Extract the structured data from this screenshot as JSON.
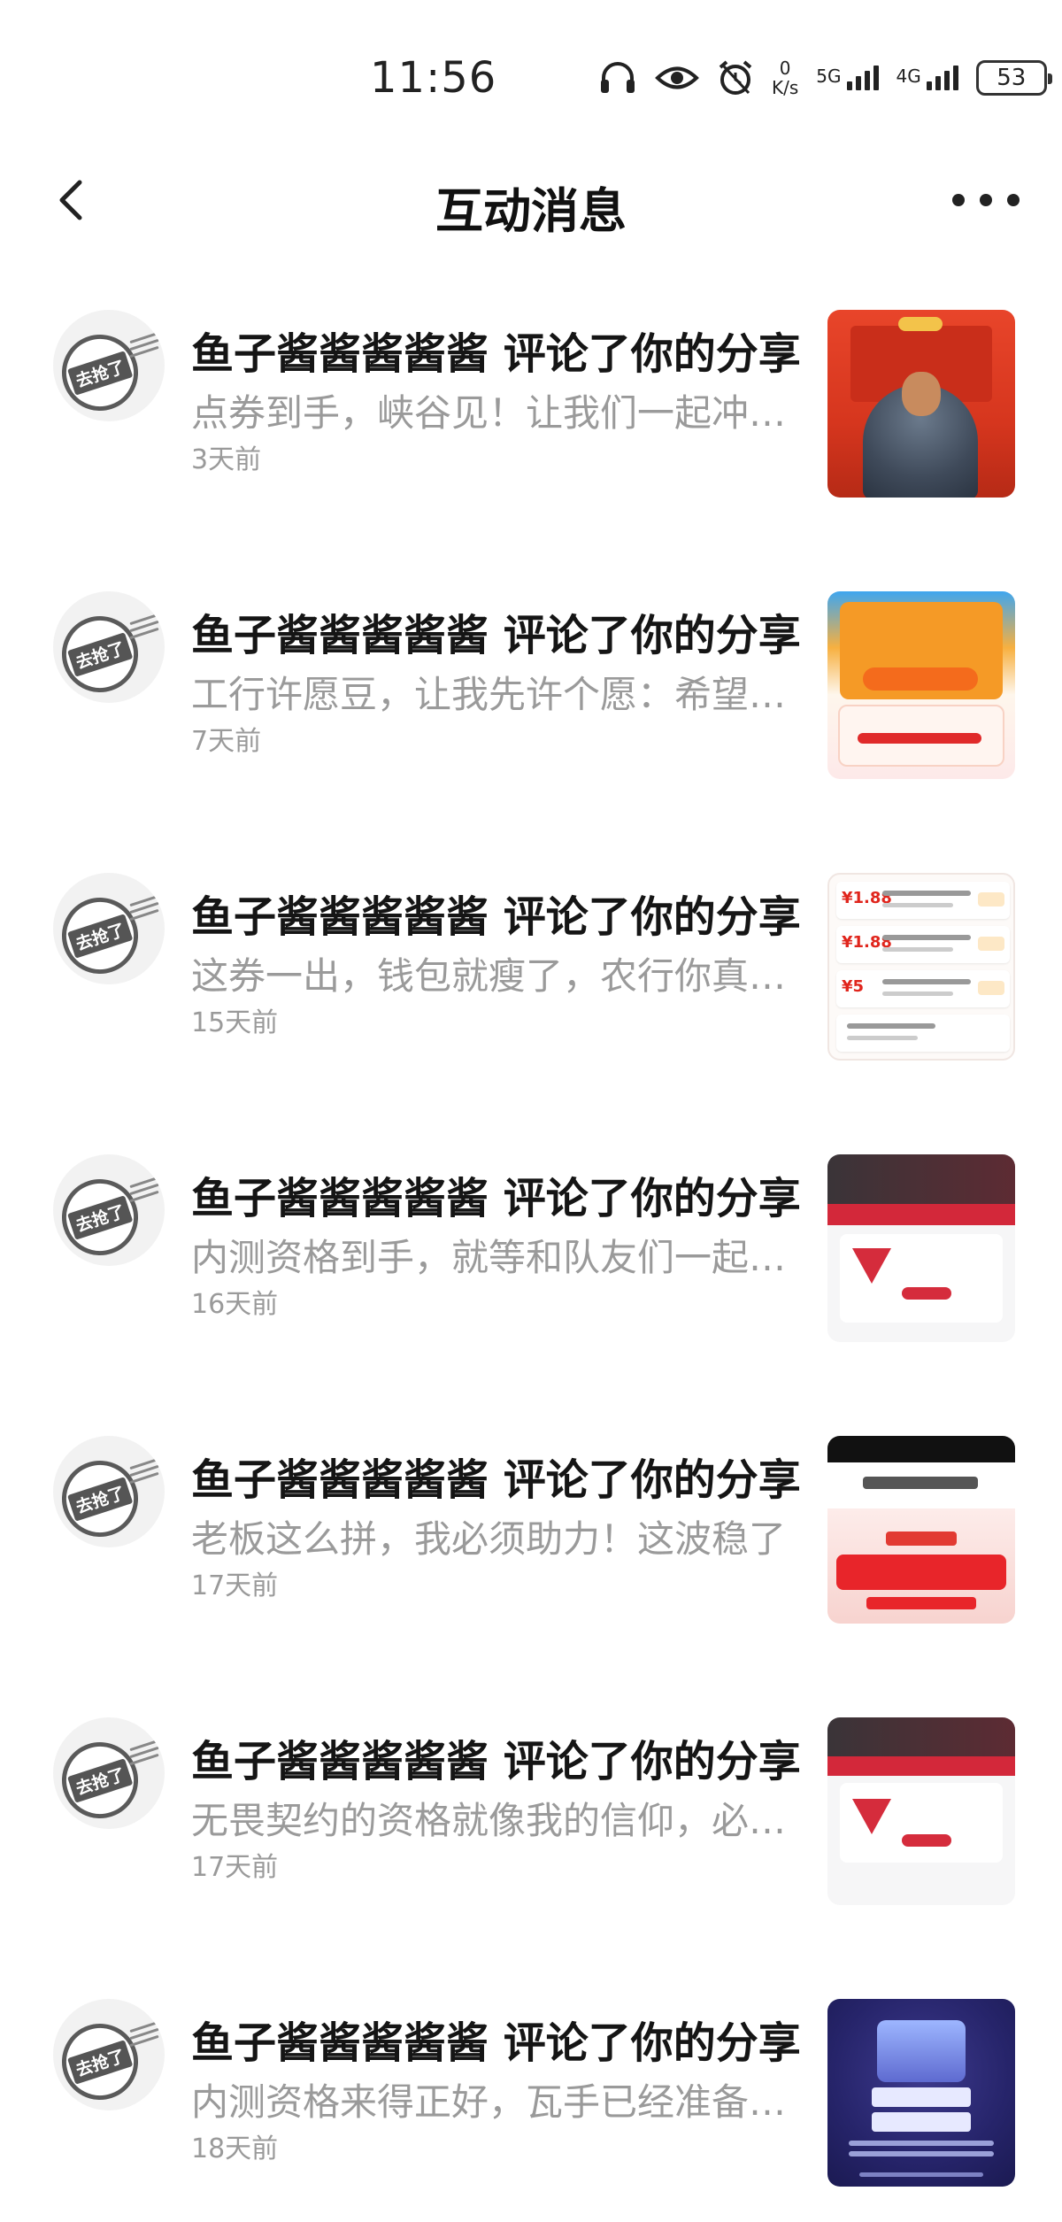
{
  "status_bar": {
    "time": "11:56",
    "net_speed_value": "0",
    "net_speed_unit": "K/s",
    "signal1_label": "5G",
    "signal2_label": "4G",
    "battery": "53",
    "icons": [
      "headphones-icon",
      "eye-icon",
      "alarm-icon"
    ]
  },
  "header": {
    "title": "互动消息"
  },
  "messages": [
    {
      "name_line": "鱼子酱酱酱酱酱 评论了你的分享",
      "preview": "点券到手，峡谷见！让我们一起冲上王者吧",
      "time_ago": "3天前",
      "avatar_text": "去抢了"
    },
    {
      "name_line": "鱼子酱酱酱酱酱 评论了你的分享",
      "preview": "工行许愿豆，让我先许个愿：希望好运连连",
      "time_ago": "7天前",
      "avatar_text": "去抢了"
    },
    {
      "name_line": "鱼子酱酱酱酱酱 评论了你的分享",
      "preview": "这券一出，钱包就瘦了，农行你真的太懂我了",
      "time_ago": "15天前",
      "avatar_text": "去抢了",
      "thumb_prices": [
        "¥1.88",
        "¥1.88",
        "¥5"
      ]
    },
    {
      "name_line": "鱼子酱酱酱酱酱 评论了你的分享",
      "preview": "内测资格到手，就等和队友们一起开黑了",
      "time_ago": "16天前",
      "avatar_text": "去抢了"
    },
    {
      "name_line": "鱼子酱酱酱酱酱 评论了你的分享",
      "preview": "老板这么拼，我必须助力！这波稳了",
      "time_ago": "17天前",
      "avatar_text": "去抢了"
    },
    {
      "name_line": "鱼子酱酱酱酱酱 评论了你的分享",
      "preview": "无畏契约的资格就像我的信仰，必须拿下",
      "time_ago": "17天前",
      "avatar_text": "去抢了"
    },
    {
      "name_line": "鱼子酱酱酱酱酱 评论了你的分享",
      "preview": "内测资格来得正好，瓦手已经准备好了",
      "time_ago": "18天前",
      "avatar_text": "去抢了"
    }
  ]
}
